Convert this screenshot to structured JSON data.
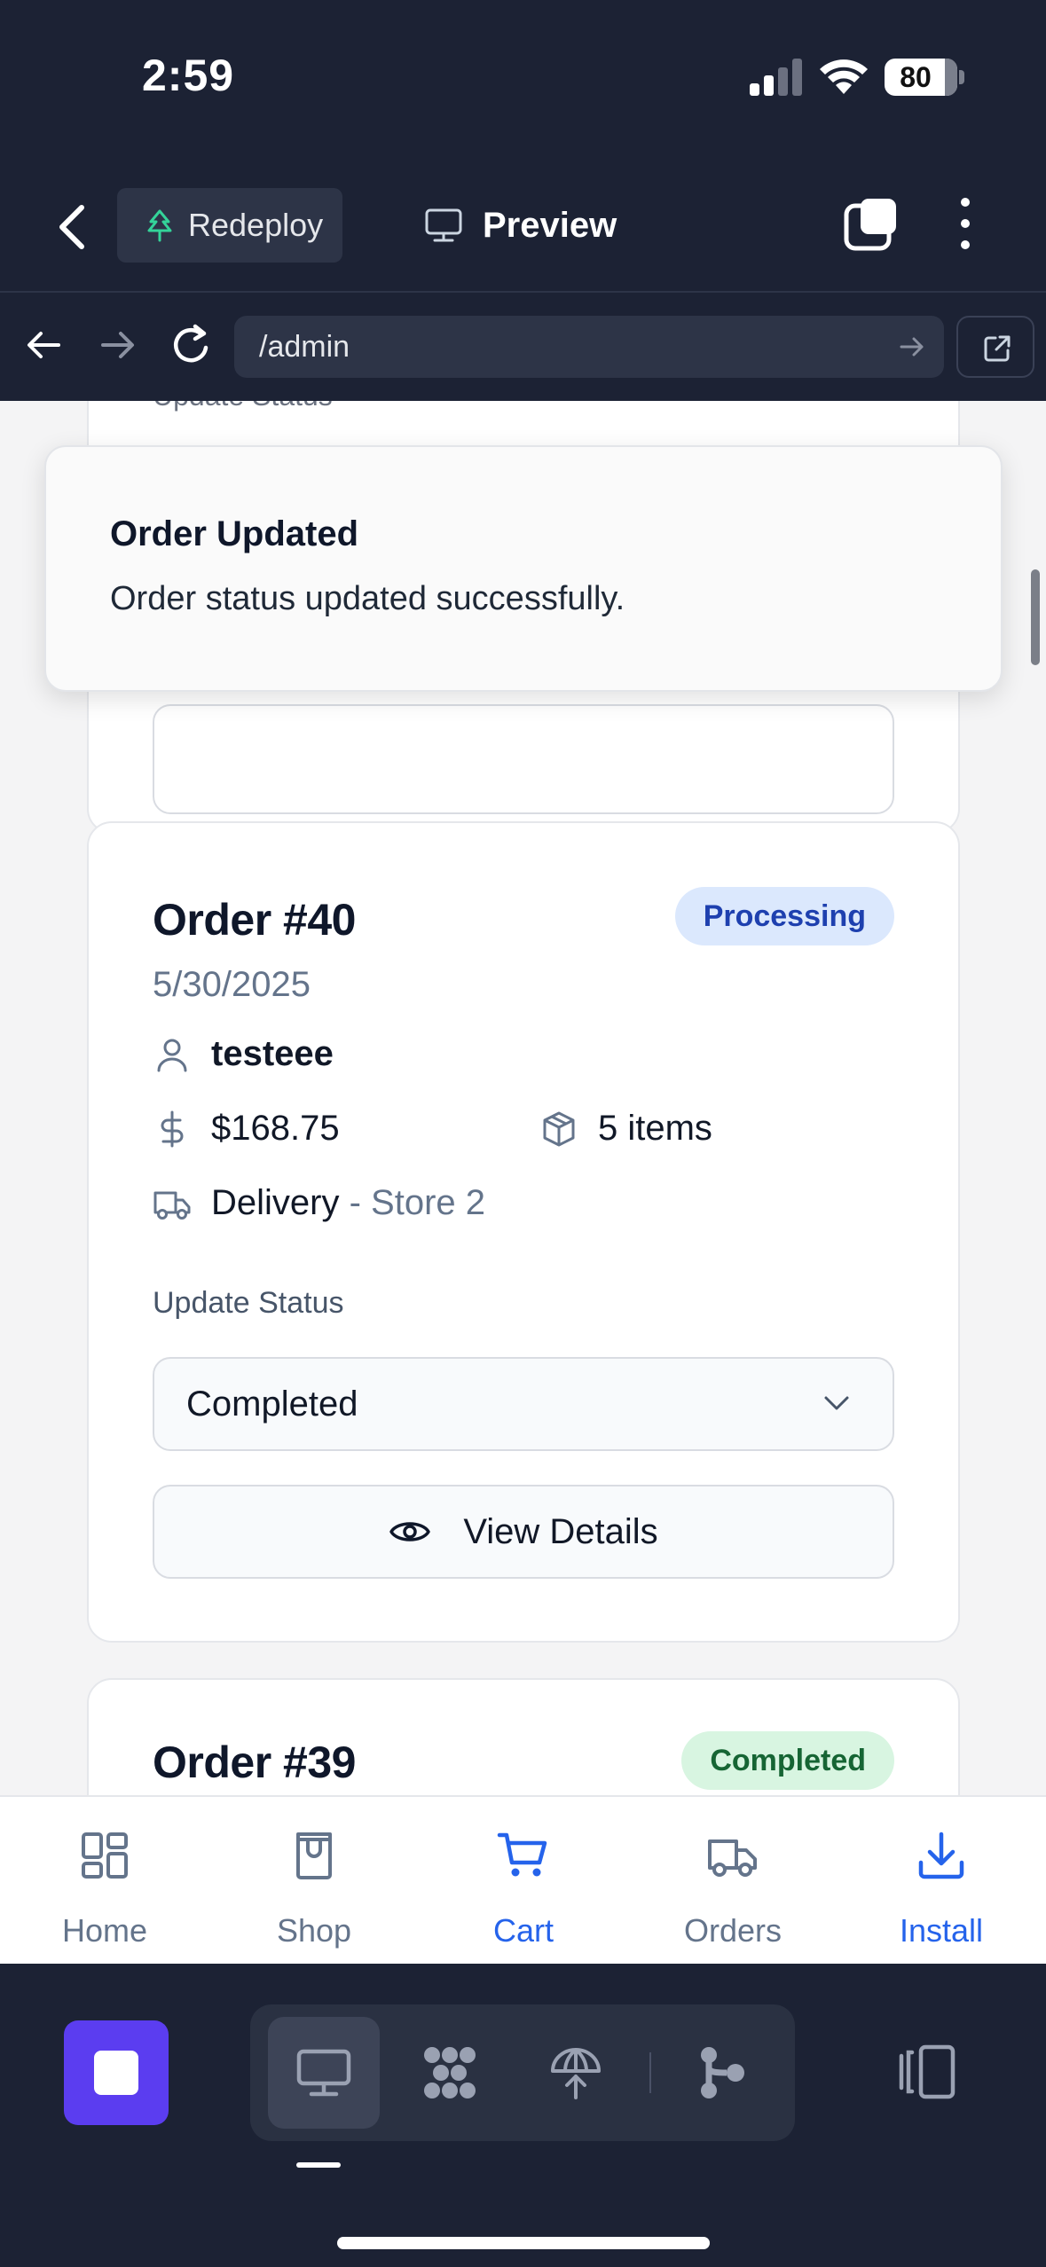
{
  "status_bar": {
    "time": "2:59",
    "battery": "80"
  },
  "toolbar": {
    "redeploy_label": "Redeploy",
    "preview_label": "Preview"
  },
  "browser": {
    "url": "/admin"
  },
  "toast": {
    "title": "Order Updated",
    "message": "Order status updated successfully."
  },
  "previous_card": {
    "update_status_label": "Update Status"
  },
  "orders": [
    {
      "title": "Order #40",
      "status": "Processing",
      "date": "5/30/2025",
      "customer": "testeee",
      "total": "$168.75",
      "items": "5 items",
      "fulfillment": "Delivery",
      "separator": " - ",
      "store": "Store 2",
      "update_status_label": "Update Status",
      "selected_status": "Completed",
      "details_label": "View Details"
    },
    {
      "title": "Order #39",
      "status": "Completed"
    }
  ],
  "bottom_nav": [
    {
      "label": "Home",
      "icon": "grid-icon",
      "active": false
    },
    {
      "label": "Shop",
      "icon": "shop-bag-icon",
      "active": false
    },
    {
      "label": "Cart",
      "icon": "cart-icon",
      "active": true
    },
    {
      "label": "Orders",
      "icon": "truck-icon",
      "active": false
    },
    {
      "label": "Install",
      "icon": "download-icon",
      "active": true
    }
  ],
  "colors": {
    "chrome_bg": "#1c2234",
    "accent_blue": "#2563eb",
    "stop_purple": "#5b3df0",
    "processing_badge_bg": "#dbe8fd",
    "completed_badge_bg": "#d8f5e1"
  }
}
